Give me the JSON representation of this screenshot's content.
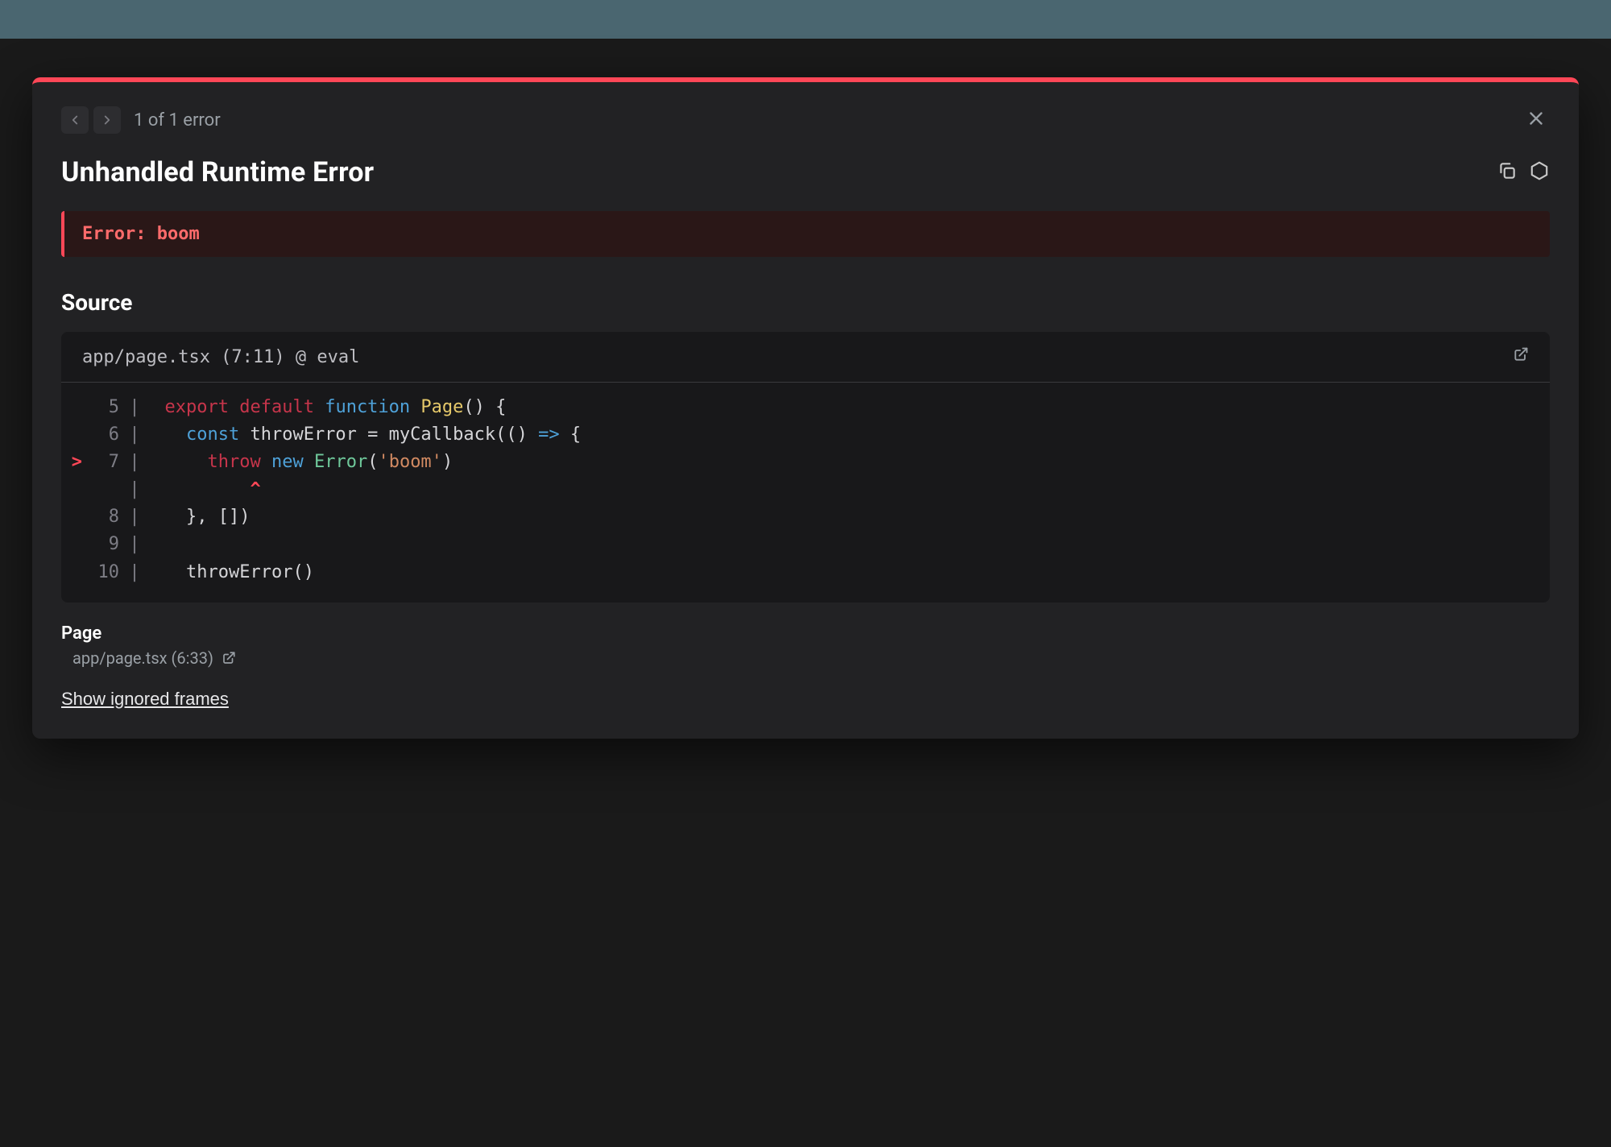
{
  "topbar": {
    "error_count": "1 of 1 error"
  },
  "title": "Unhandled Runtime Error",
  "error_banner": "Error: boom",
  "source": {
    "heading": "Source",
    "location": "app/page.tsx (7:11) @ eval",
    "lines": [
      {
        "marker": "",
        "ln": "5",
        "html": "<span class='tok-kw'>export</span> <span class='tok-kw'>default</span> <span class='tok-kw2'>function</span> <span class='tok-fn'>Page</span><span class='tok-punc'>()</span> <span class='tok-punc'>{</span>"
      },
      {
        "marker": "",
        "ln": "6",
        "html": "  <span class='tok-kw2'>const</span> <span class='tok-var'>throwError</span> <span class='tok-punc'>=</span> <span class='tok-var'>myCallback</span><span class='tok-punc'>((</span><span class='tok-punc'>)</span> <span class='tok-arrow'>=&gt;</span> <span class='tok-punc'>{</span>"
      },
      {
        "marker": ">",
        "ln": "7",
        "html": "    <span class='tok-kw'>throw</span> <span class='tok-kw2'>new</span> <span class='tok-type'>Error</span><span class='tok-punc'>(</span><span class='tok-str'>'boom'</span><span class='tok-punc'>)</span>"
      },
      {
        "marker": "",
        "ln": "",
        "html": "        <span class='caret'>^</span>"
      },
      {
        "marker": "",
        "ln": "8",
        "html": "  <span class='tok-punc'>}</span><span class='tok-punc'>,</span> <span class='tok-punc'>[</span><span class='tok-punc'>]</span><span class='tok-punc'>)</span>"
      },
      {
        "marker": "",
        "ln": "9",
        "html": ""
      },
      {
        "marker": "",
        "ln": "10",
        "html": "  <span class='tok-var'>throwError</span><span class='tok-punc'>(</span><span class='tok-punc'>)</span>"
      }
    ]
  },
  "frame": {
    "name": "Page",
    "location": "app/page.tsx (6:33)"
  },
  "show_ignored": "Show ignored frames"
}
